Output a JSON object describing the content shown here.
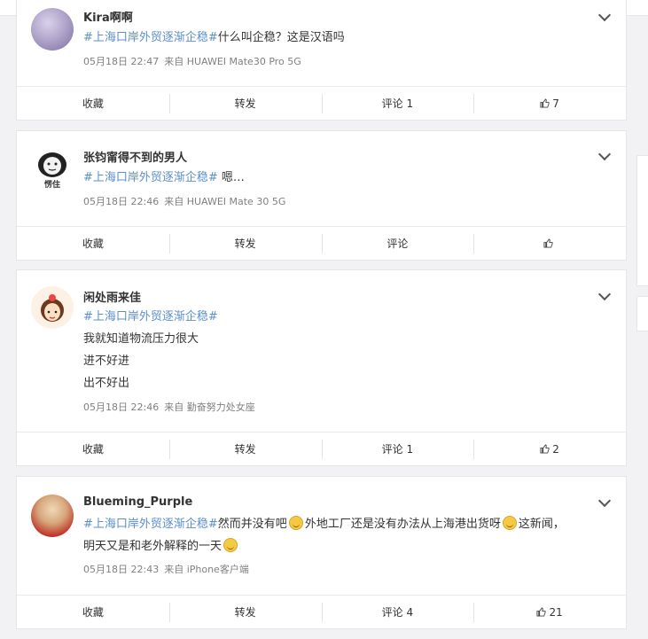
{
  "colors": {
    "tag": "#5b8fc9",
    "meta": "#808080",
    "border": "#e6e6e6"
  },
  "posts": [
    {
      "name": "Kira啊啊",
      "hashtag": "#上海口岸外贸逐渐企稳#",
      "text": "什么叫企稳？这是汉语吗",
      "time": "05月18日 22:47",
      "source": "来自 HUAWEI Mate30 Pro 5G",
      "actions": {
        "fav": "收藏",
        "share": "转发",
        "comment": "评论 1",
        "like": "7"
      }
    },
    {
      "name": "张钧甯得不到的男人",
      "hashtag": "#上海口岸外贸逐渐企稳#",
      "text": " 嗯…",
      "avatar_caption": "愣住",
      "time": "05月18日 22:46",
      "source": "来自 HUAWEI Mate 30 5G",
      "actions": {
        "fav": "收藏",
        "share": "转发",
        "comment": "评论",
        "like": ""
      }
    },
    {
      "name": "闲处雨来佳",
      "hashtag": "#上海口岸外贸逐渐企稳#",
      "lines": [
        "我就知道物流压力很大",
        "进不好进",
        "出不好出"
      ],
      "time": "05月18日 22:46",
      "source": "来自 勤奋努力处女座",
      "actions": {
        "fav": "收藏",
        "share": "转发",
        "comment": "评论 1",
        "like": "2"
      }
    },
    {
      "name": "Blueming_Purple",
      "hashtag": "#上海口岸外贸逐渐企稳#",
      "text_a": "然而并没有吧",
      "text_b": "外地工厂还是没有办法从上海港出货呀",
      "text_c": "这新闻，",
      "text_d": "明天又是和老外解释的一天",
      "time": "05月18日 22:43",
      "source": "来自 iPhone客户端",
      "actions": {
        "fav": "收藏",
        "share": "转发",
        "comment": "评论 4",
        "like": "21"
      }
    }
  ]
}
